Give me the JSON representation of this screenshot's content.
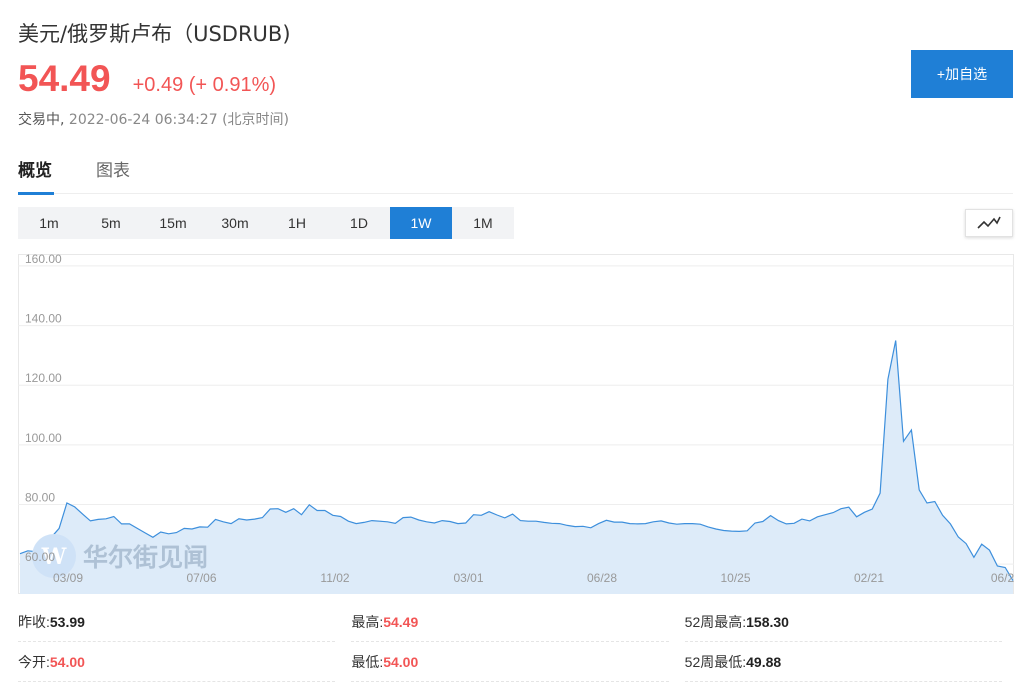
{
  "header": {
    "title": "美元/俄罗斯卢布（USDRUB)",
    "price": "54.49",
    "change": "+0.49 (+ 0.91%)",
    "status": "交易中,",
    "timestamp": "2022-06-24 06:34:27",
    "timezone": "(北京时间)"
  },
  "actions": {
    "add_watchlist": "+加自选"
  },
  "tabs": [
    {
      "label": "概览",
      "active": true
    },
    {
      "label": "图表",
      "active": false
    }
  ],
  "periods": [
    {
      "label": "1m",
      "active": false
    },
    {
      "label": "5m",
      "active": false
    },
    {
      "label": "15m",
      "active": false
    },
    {
      "label": "30m",
      "active": false
    },
    {
      "label": "1H",
      "active": false
    },
    {
      "label": "1D",
      "active": false
    },
    {
      "label": "1W",
      "active": true
    },
    {
      "label": "1M",
      "active": false
    }
  ],
  "chart_type_icon": "line-chart-icon",
  "watermark": "华尔街见闻",
  "colors": {
    "accent": "#1f7fd6",
    "up": "#f25555",
    "line": "#3d8fdc",
    "fill": "#ddebf9"
  },
  "chart_data": {
    "type": "area",
    "ylim": [
      50,
      164
    ],
    "y_ticks": [
      60,
      80,
      100,
      120,
      140,
      160
    ],
    "y_tick_labels": [
      "60.00",
      "80.00",
      "100.00",
      "120.00",
      "140.00",
      "160.00"
    ],
    "x_tick_labels": [
      "03/09",
      "07/06",
      "11/02",
      "03/01",
      "06/28",
      "10/25",
      "02/21",
      "06/2"
    ],
    "grid": true,
    "legend": "none",
    "series": [
      {
        "values": [
          63.5,
          64.5,
          64.2,
          65.1,
          69,
          72,
          80.5,
          79.2,
          76.8,
          74.5,
          75,
          75.2,
          76,
          73.5,
          73.5,
          72,
          70.5,
          69,
          70.8,
          70.2,
          70.6,
          72,
          71.8,
          72.5,
          72.4,
          75,
          74.2,
          73.6,
          75.2,
          74.8,
          75.1,
          75.6,
          78.5,
          78.6,
          77.4,
          78.6,
          76.6,
          79.9,
          78,
          78,
          76.4,
          76,
          74.4,
          73.6,
          74,
          74.6,
          74.4,
          74.2,
          73.7,
          75.6,
          75.8,
          74.8,
          74.2,
          73.8,
          74.6,
          74.3,
          73.6,
          73.8,
          76.6,
          76.4,
          77.6,
          76.5,
          75.5,
          76.8,
          74.6,
          74.4,
          74.4,
          74,
          73.7,
          73.6,
          73,
          72.6,
          72.7,
          72.2,
          73.6,
          74.7,
          74.1,
          74.1,
          73.6,
          73.5,
          73.6,
          74.2,
          74.5,
          73.8,
          73.4,
          73.6,
          73.6,
          73.4,
          72.5,
          71.8,
          71.3,
          71.1,
          71,
          71.2,
          73.8,
          74.3,
          76.3,
          74.6,
          73.5,
          73.7,
          75.1,
          74.5,
          75.9,
          76.6,
          77.3,
          78.6,
          79.1,
          75.9,
          77.4,
          78.5,
          83.8,
          122,
          135,
          101.2,
          105,
          84.9,
          80.5,
          81,
          76.4,
          73.5,
          69.1,
          66.9,
          62.3,
          66.7,
          64.7,
          59.4,
          58.9,
          54.5
        ]
      }
    ]
  },
  "stats": [
    [
      {
        "label": "昨收:",
        "value": "53.99",
        "red": false
      },
      {
        "label": "最高:",
        "value": "54.49",
        "red": true
      },
      {
        "label": "52周最高:",
        "value": "158.30",
        "red": false
      }
    ],
    [
      {
        "label": "今开:",
        "value": "54.00",
        "red": true
      },
      {
        "label": "最低:",
        "value": "54.00",
        "red": true
      },
      {
        "label": "52周最低:",
        "value": "49.88",
        "red": false
      }
    ]
  ]
}
